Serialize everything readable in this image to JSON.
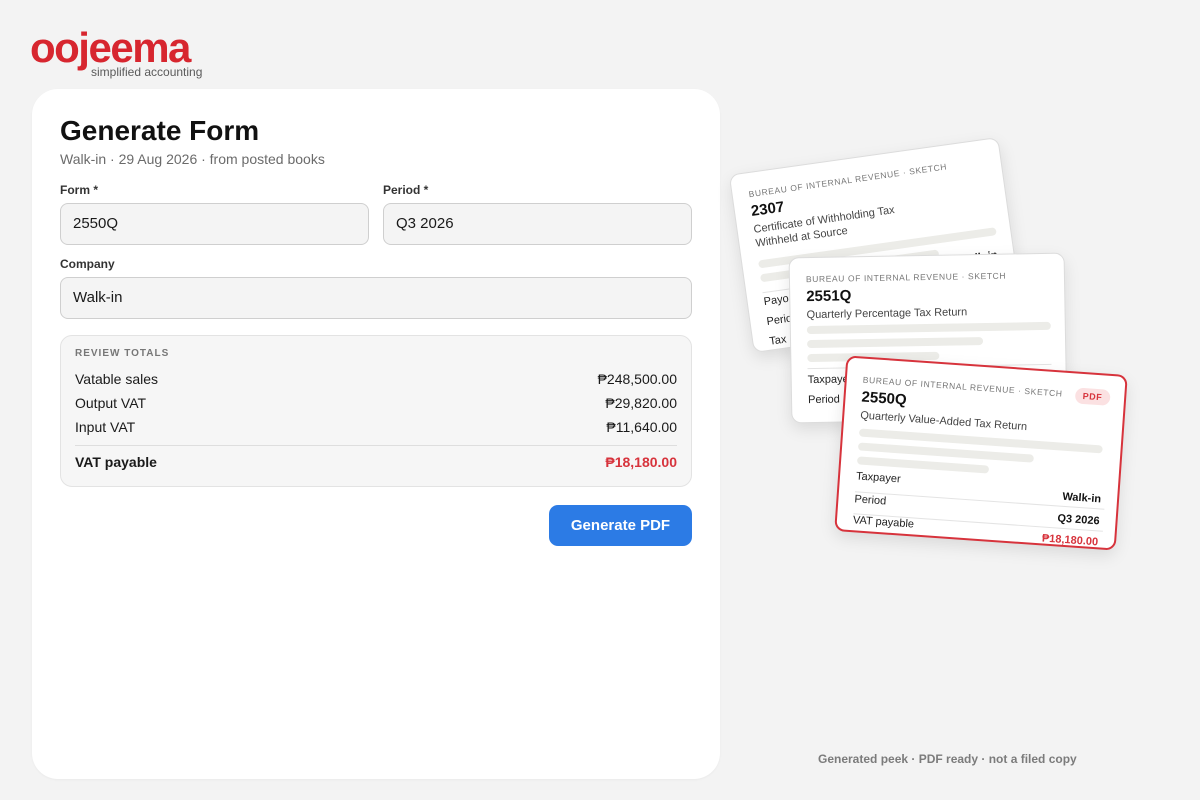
{
  "brand": {
    "name": "oojeema",
    "tagline": "simplified accounting",
    "color": "#d7262f"
  },
  "form": {
    "title": "Generate Form",
    "subtitle": "Walk-in · 29 Aug 2026 · from posted books",
    "form_label": "Form *",
    "form_value": "2550Q",
    "period_label": "Period *",
    "period_value": "Q3 2026",
    "company_label": "Company",
    "company_value": "Walk-in"
  },
  "review": {
    "heading": "REVIEW TOTALS",
    "rows": [
      {
        "label": "Vatable sales",
        "value": "₱248,500.00"
      },
      {
        "label": "Output VAT",
        "value": "₱29,820.00"
      },
      {
        "label": "Input VAT",
        "value": "₱11,640.00"
      }
    ],
    "total_label": "VAT payable",
    "total_value": "₱18,180.00"
  },
  "actions": {
    "generate_label": "Generate PDF",
    "accent": "#2c7be5"
  },
  "preview": {
    "sheets": [
      {
        "header": "BUREAU OF INTERNAL REVENUE · SKETCH",
        "code": "2307",
        "name_line1": "Certificate of Withholding Tax",
        "name_line2": "Withheld at Source",
        "rows": [
          {
            "label": "Payo",
            "value": "Walk-in"
          },
          {
            "label": "Perio",
            "value": ""
          },
          {
            "label": "Tax",
            "value": ""
          }
        ]
      },
      {
        "header": "BUREAU OF INTERNAL REVENUE · SKETCH",
        "code": "2551Q",
        "name_line1": "Quarterly Percentage Tax Return",
        "rows": [
          {
            "label": "Taxpaye",
            "value": ""
          },
          {
            "label": "Period",
            "value": ""
          }
        ]
      },
      {
        "header": "BUREAU OF INTERNAL REVENUE · SKETCH",
        "code": "2550Q",
        "name_line1": "Quarterly Value-Added Tax Return",
        "badge": "PDF",
        "rows": [
          {
            "label": "Taxpayer",
            "value": "Walk-in"
          },
          {
            "label": "Period",
            "value": "Q3 2026"
          },
          {
            "label": "VAT payable",
            "value": "₱18,180.00"
          }
        ]
      }
    ],
    "footnote": "Generated peek · PDF ready · not a filed copy"
  }
}
